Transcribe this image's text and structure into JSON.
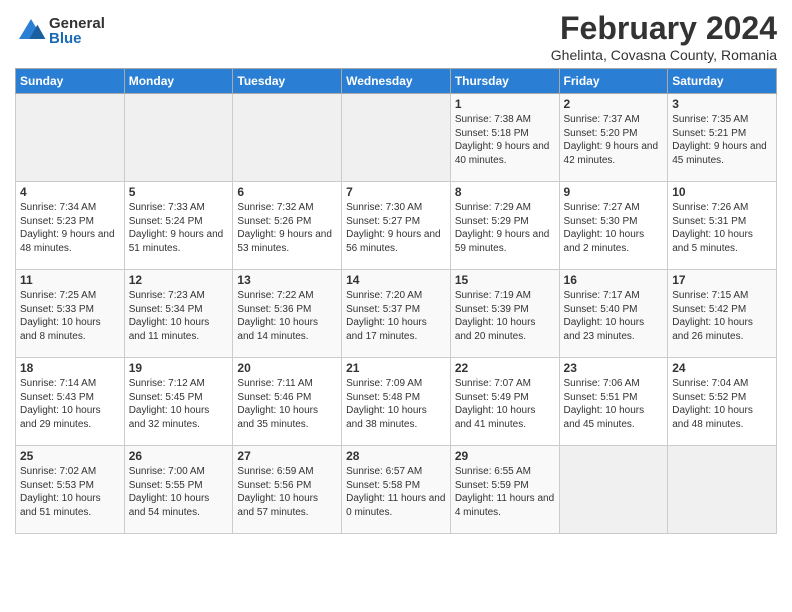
{
  "header": {
    "logo_general": "General",
    "logo_blue": "Blue",
    "month_title": "February 2024",
    "location": "Ghelinta, Covasna County, Romania"
  },
  "days_of_week": [
    "Sunday",
    "Monday",
    "Tuesday",
    "Wednesday",
    "Thursday",
    "Friday",
    "Saturday"
  ],
  "weeks": [
    [
      {
        "date": "",
        "info": ""
      },
      {
        "date": "",
        "info": ""
      },
      {
        "date": "",
        "info": ""
      },
      {
        "date": "",
        "info": ""
      },
      {
        "date": "1",
        "info": "Sunrise: 7:38 AM\nSunset: 5:18 PM\nDaylight: 9 hours\nand 40 minutes."
      },
      {
        "date": "2",
        "info": "Sunrise: 7:37 AM\nSunset: 5:20 PM\nDaylight: 9 hours\nand 42 minutes."
      },
      {
        "date": "3",
        "info": "Sunrise: 7:35 AM\nSunset: 5:21 PM\nDaylight: 9 hours\nand 45 minutes."
      }
    ],
    [
      {
        "date": "4",
        "info": "Sunrise: 7:34 AM\nSunset: 5:23 PM\nDaylight: 9 hours\nand 48 minutes."
      },
      {
        "date": "5",
        "info": "Sunrise: 7:33 AM\nSunset: 5:24 PM\nDaylight: 9 hours\nand 51 minutes."
      },
      {
        "date": "6",
        "info": "Sunrise: 7:32 AM\nSunset: 5:26 PM\nDaylight: 9 hours\nand 53 minutes."
      },
      {
        "date": "7",
        "info": "Sunrise: 7:30 AM\nSunset: 5:27 PM\nDaylight: 9 hours\nand 56 minutes."
      },
      {
        "date": "8",
        "info": "Sunrise: 7:29 AM\nSunset: 5:29 PM\nDaylight: 9 hours\nand 59 minutes."
      },
      {
        "date": "9",
        "info": "Sunrise: 7:27 AM\nSunset: 5:30 PM\nDaylight: 10 hours\nand 2 minutes."
      },
      {
        "date": "10",
        "info": "Sunrise: 7:26 AM\nSunset: 5:31 PM\nDaylight: 10 hours\nand 5 minutes."
      }
    ],
    [
      {
        "date": "11",
        "info": "Sunrise: 7:25 AM\nSunset: 5:33 PM\nDaylight: 10 hours\nand 8 minutes."
      },
      {
        "date": "12",
        "info": "Sunrise: 7:23 AM\nSunset: 5:34 PM\nDaylight: 10 hours\nand 11 minutes."
      },
      {
        "date": "13",
        "info": "Sunrise: 7:22 AM\nSunset: 5:36 PM\nDaylight: 10 hours\nand 14 minutes."
      },
      {
        "date": "14",
        "info": "Sunrise: 7:20 AM\nSunset: 5:37 PM\nDaylight: 10 hours\nand 17 minutes."
      },
      {
        "date": "15",
        "info": "Sunrise: 7:19 AM\nSunset: 5:39 PM\nDaylight: 10 hours\nand 20 minutes."
      },
      {
        "date": "16",
        "info": "Sunrise: 7:17 AM\nSunset: 5:40 PM\nDaylight: 10 hours\nand 23 minutes."
      },
      {
        "date": "17",
        "info": "Sunrise: 7:15 AM\nSunset: 5:42 PM\nDaylight: 10 hours\nand 26 minutes."
      }
    ],
    [
      {
        "date": "18",
        "info": "Sunrise: 7:14 AM\nSunset: 5:43 PM\nDaylight: 10 hours\nand 29 minutes."
      },
      {
        "date": "19",
        "info": "Sunrise: 7:12 AM\nSunset: 5:45 PM\nDaylight: 10 hours\nand 32 minutes."
      },
      {
        "date": "20",
        "info": "Sunrise: 7:11 AM\nSunset: 5:46 PM\nDaylight: 10 hours\nand 35 minutes."
      },
      {
        "date": "21",
        "info": "Sunrise: 7:09 AM\nSunset: 5:48 PM\nDaylight: 10 hours\nand 38 minutes."
      },
      {
        "date": "22",
        "info": "Sunrise: 7:07 AM\nSunset: 5:49 PM\nDaylight: 10 hours\nand 41 minutes."
      },
      {
        "date": "23",
        "info": "Sunrise: 7:06 AM\nSunset: 5:51 PM\nDaylight: 10 hours\nand 45 minutes."
      },
      {
        "date": "24",
        "info": "Sunrise: 7:04 AM\nSunset: 5:52 PM\nDaylight: 10 hours\nand 48 minutes."
      }
    ],
    [
      {
        "date": "25",
        "info": "Sunrise: 7:02 AM\nSunset: 5:53 PM\nDaylight: 10 hours\nand 51 minutes."
      },
      {
        "date": "26",
        "info": "Sunrise: 7:00 AM\nSunset: 5:55 PM\nDaylight: 10 hours\nand 54 minutes."
      },
      {
        "date": "27",
        "info": "Sunrise: 6:59 AM\nSunset: 5:56 PM\nDaylight: 10 hours\nand 57 minutes."
      },
      {
        "date": "28",
        "info": "Sunrise: 6:57 AM\nSunset: 5:58 PM\nDaylight: 11 hours\nand 0 minutes."
      },
      {
        "date": "29",
        "info": "Sunrise: 6:55 AM\nSunset: 5:59 PM\nDaylight: 11 hours\nand 4 minutes."
      },
      {
        "date": "",
        "info": ""
      },
      {
        "date": "",
        "info": ""
      }
    ]
  ]
}
